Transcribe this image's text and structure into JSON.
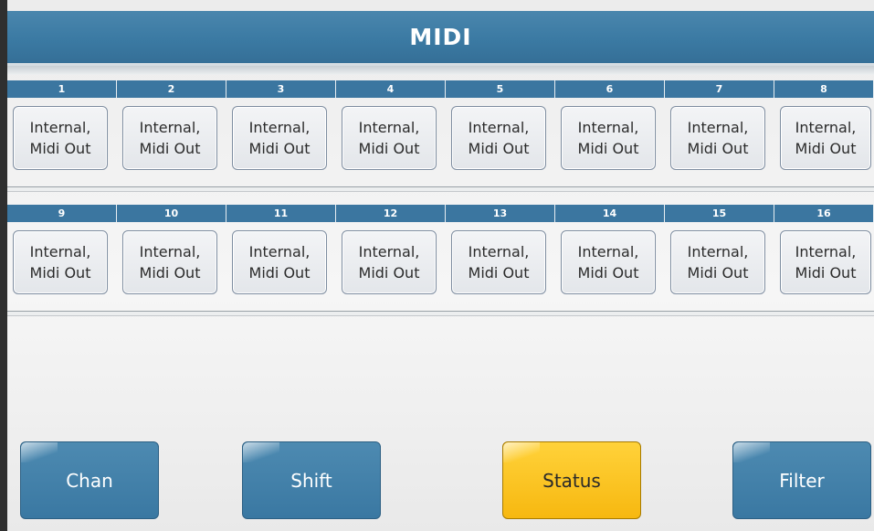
{
  "title": "MIDI",
  "channels_row1": [
    {
      "number": "1",
      "line1": "Internal,",
      "line2": "Midi Out"
    },
    {
      "number": "2",
      "line1": "Internal,",
      "line2": "Midi Out"
    },
    {
      "number": "3",
      "line1": "Internal,",
      "line2": "Midi Out"
    },
    {
      "number": "4",
      "line1": "Internal,",
      "line2": "Midi Out"
    },
    {
      "number": "5",
      "line1": "Internal,",
      "line2": "Midi Out"
    },
    {
      "number": "6",
      "line1": "Internal,",
      "line2": "Midi Out"
    },
    {
      "number": "7",
      "line1": "Internal,",
      "line2": "Midi Out"
    },
    {
      "number": "8",
      "line1": "Internal,",
      "line2": "Midi Out"
    }
  ],
  "channels_row2": [
    {
      "number": "9",
      "line1": "Internal,",
      "line2": "Midi Out"
    },
    {
      "number": "10",
      "line1": "Internal,",
      "line2": "Midi Out"
    },
    {
      "number": "11",
      "line1": "Internal,",
      "line2": "Midi Out"
    },
    {
      "number": "12",
      "line1": "Internal,",
      "line2": "Midi Out"
    },
    {
      "number": "13",
      "line1": "Internal,",
      "line2": "Midi Out"
    },
    {
      "number": "14",
      "line1": "Internal,",
      "line2": "Midi Out"
    },
    {
      "number": "15",
      "line1": "Internal,",
      "line2": "Midi Out"
    },
    {
      "number": "16",
      "line1": "Internal,",
      "line2": "Midi Out"
    }
  ],
  "function_buttons": {
    "chan": "Chan",
    "shift": "Shift",
    "status": "Status",
    "filter": "Filter"
  },
  "colors": {
    "header_blue": "#3b76a0",
    "active_gold": "#f7b810"
  }
}
